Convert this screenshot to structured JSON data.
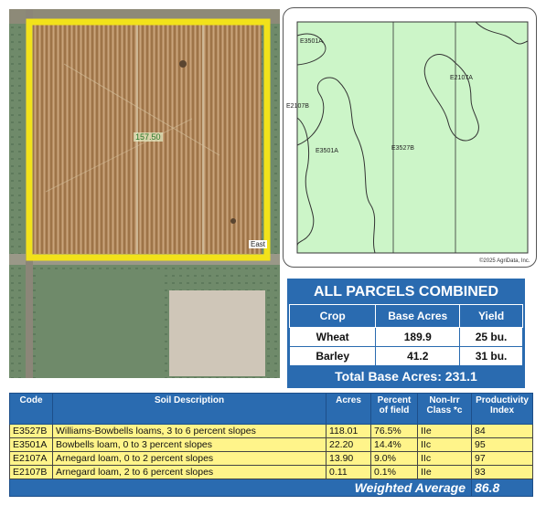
{
  "aerial": {
    "field_acres_label": "157.50",
    "road_label": "East"
  },
  "soil_map": {
    "unit_labels": [
      "E3501A",
      "E2107B",
      "E3501A",
      "E3527B",
      "E2107A"
    ],
    "copyright": "©2025 AgriData, Inc."
  },
  "parcels": {
    "title": "ALL PARCELS COMBINED",
    "headers": [
      "Crop",
      "Base Acres",
      "Yield"
    ],
    "rows": [
      {
        "crop": "Wheat",
        "base_acres": "189.9",
        "yield": "25 bu."
      },
      {
        "crop": "Barley",
        "base_acres": "41.2",
        "yield": "31 bu."
      }
    ],
    "total_label": "Total Base Acres:",
    "total_value": "231.1"
  },
  "soils": {
    "headers": [
      "Code",
      "Soil Description",
      "Acres",
      "Percent of field",
      "Non-Irr Class *c",
      "Productivity Index"
    ],
    "rows": [
      {
        "code": "E3527B",
        "description": "Williams-Bowbells loams, 3 to 6 percent slopes",
        "acres": "118.01",
        "percent": "76.5%",
        "class": "IIe",
        "index": "84"
      },
      {
        "code": "E3501A",
        "description": "Bowbells loam, 0 to 3 percent slopes",
        "acres": "22.20",
        "percent": "14.4%",
        "class": "IIc",
        "index": "95"
      },
      {
        "code": "E2107A",
        "description": "Arnegard loam, 0 to 2 percent slopes",
        "acres": "13.90",
        "percent": "9.0%",
        "class": "IIc",
        "index": "97"
      },
      {
        "code": "E2107B",
        "description": "Arnegard loam, 2 to 6 percent slopes",
        "acres": "0.11",
        "percent": "0.1%",
        "class": "IIe",
        "index": "93"
      }
    ],
    "weighted_label": "Weighted Average",
    "weighted_value": "86.8"
  },
  "colors": {
    "header_blue": "#2a6bb0",
    "row_yellow": "#fff48a",
    "boundary_yellow": "#f2e21a",
    "soil_green": "#ccf5c8"
  }
}
